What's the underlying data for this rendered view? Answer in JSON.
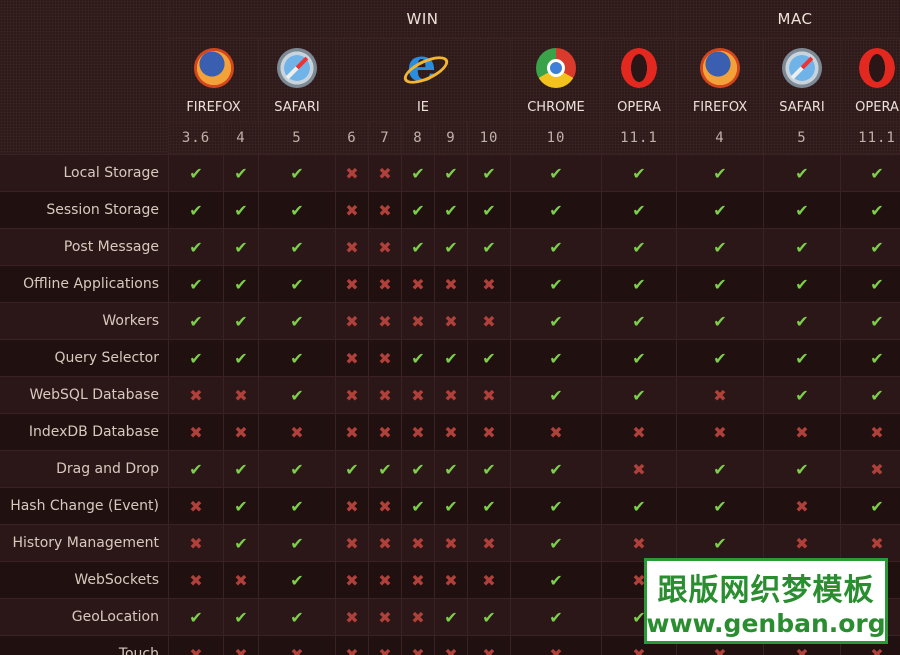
{
  "platforms": [
    {
      "label": "WIN",
      "colspan": 10
    },
    {
      "label": "MAC",
      "colspan": 3
    }
  ],
  "browsers": [
    {
      "name": "FIREFOX",
      "icon": "firefox-icon",
      "platform": "WIN",
      "versions": [
        "3.6",
        "4"
      ]
    },
    {
      "name": "SAFARI",
      "icon": "safari-icon",
      "platform": "WIN",
      "versions": [
        "5"
      ]
    },
    {
      "name": "IE",
      "icon": "ie-icon",
      "platform": "WIN",
      "versions": [
        "6",
        "7",
        "8",
        "9",
        "10"
      ]
    },
    {
      "name": "CHROME",
      "icon": "chrome-icon",
      "platform": "WIN",
      "versions": [
        "10"
      ]
    },
    {
      "name": "OPERA",
      "icon": "opera-icon",
      "platform": "WIN",
      "versions": [
        "11.1"
      ]
    },
    {
      "name": "FIREFOX",
      "icon": "firefox-icon",
      "platform": "MAC",
      "versions": [
        "4"
      ]
    },
    {
      "name": "SAFARI",
      "icon": "safari-icon",
      "platform": "MAC",
      "versions": [
        "5"
      ]
    },
    {
      "name": "OPERA",
      "icon": "opera-icon",
      "platform": "MAC",
      "versions": [
        "11.1"
      ]
    }
  ],
  "columns": [
    "win-firefox-3.6",
    "win-firefox-4",
    "win-safari-5",
    "win-ie-6",
    "win-ie-7",
    "win-ie-8",
    "win-ie-9",
    "win-ie-10",
    "win-chrome-10",
    "win-opera-11.1",
    "mac-firefox-4",
    "mac-safari-5",
    "mac-opera-11.1"
  ],
  "symbols": {
    "yes": "✔",
    "no": "✖"
  },
  "colors": {
    "yes": "#7ccf4a",
    "no": "#b0403a",
    "background": "#241414"
  },
  "features": [
    {
      "name": "Local Storage",
      "support": [
        1,
        1,
        1,
        0,
        0,
        1,
        1,
        1,
        1,
        1,
        1,
        1,
        1
      ]
    },
    {
      "name": "Session Storage",
      "support": [
        1,
        1,
        1,
        0,
        0,
        1,
        1,
        1,
        1,
        1,
        1,
        1,
        1
      ]
    },
    {
      "name": "Post Message",
      "support": [
        1,
        1,
        1,
        0,
        0,
        1,
        1,
        1,
        1,
        1,
        1,
        1,
        1
      ]
    },
    {
      "name": "Offline Applications",
      "support": [
        1,
        1,
        1,
        0,
        0,
        0,
        0,
        0,
        1,
        1,
        1,
        1,
        1
      ]
    },
    {
      "name": "Workers",
      "support": [
        1,
        1,
        1,
        0,
        0,
        0,
        0,
        0,
        1,
        1,
        1,
        1,
        1
      ]
    },
    {
      "name": "Query Selector",
      "support": [
        1,
        1,
        1,
        0,
        0,
        1,
        1,
        1,
        1,
        1,
        1,
        1,
        1
      ]
    },
    {
      "name": "WebSQL Database",
      "support": [
        0,
        0,
        1,
        0,
        0,
        0,
        0,
        0,
        1,
        1,
        0,
        1,
        1
      ]
    },
    {
      "name": "IndexDB Database",
      "support": [
        0,
        0,
        0,
        0,
        0,
        0,
        0,
        0,
        0,
        0,
        0,
        0,
        0
      ]
    },
    {
      "name": "Drag and Drop",
      "support": [
        1,
        1,
        1,
        1,
        1,
        1,
        1,
        1,
        1,
        0,
        1,
        1,
        0
      ]
    },
    {
      "name": "Hash Change (Event)",
      "support": [
        0,
        1,
        1,
        0,
        0,
        1,
        1,
        1,
        1,
        1,
        1,
        0,
        1
      ]
    },
    {
      "name": "History Management",
      "support": [
        0,
        1,
        1,
        0,
        0,
        0,
        0,
        0,
        1,
        0,
        1,
        0,
        0
      ]
    },
    {
      "name": "WebSockets",
      "support": [
        0,
        0,
        1,
        0,
        0,
        0,
        0,
        0,
        1,
        0,
        0,
        0,
        0
      ]
    },
    {
      "name": "GeoLocation",
      "support": [
        1,
        1,
        1,
        0,
        0,
        0,
        1,
        1,
        1,
        1,
        0,
        0,
        0
      ]
    },
    {
      "name": "Touch",
      "support": [
        0,
        0,
        0,
        0,
        0,
        0,
        0,
        0,
        0,
        0,
        0,
        0,
        0
      ]
    }
  ],
  "watermark": {
    "chinese": "跟版网织梦模板",
    "url": "www.genban.org"
  }
}
